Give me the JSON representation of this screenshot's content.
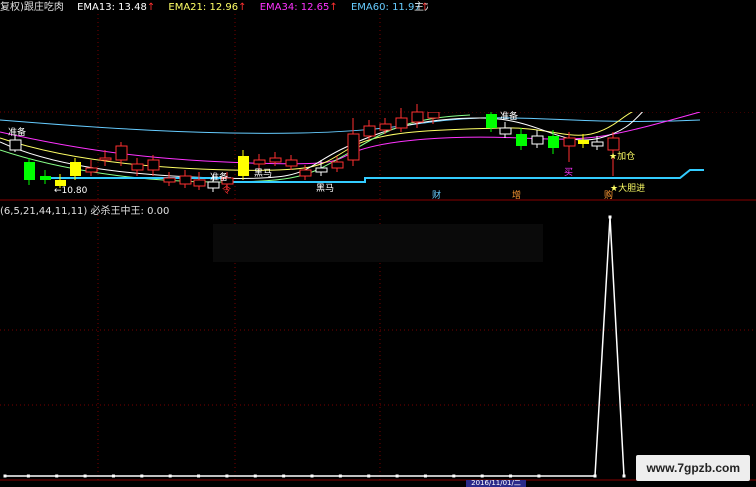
{
  "header": {
    "prefix": "复权)",
    "indicator_name": "跟庄吃肉",
    "ema13_label": "EMA13:",
    "ema13_value": "13.48",
    "ema21_label": "EMA21:",
    "ema21_value": "12.96",
    "ema34_label": "EMA34:",
    "ema34_value": "12.65",
    "ema60_label": "EMA60:",
    "ema60_value": "11.97",
    "arrow": "↑",
    "right_text": "主力"
  },
  "colors": {
    "ema13": "#ffffff",
    "ema21": "#ffff66",
    "ema34": "#ff33ff",
    "ema60": "#66ccff",
    "up_candle": "#ff3030",
    "down_candle": "#00ff00",
    "signal_candle": "#ffff00",
    "support_line": "#33ccff",
    "grid": "#880000"
  },
  "labels": {
    "zhunbei1": "准备",
    "zhunbei2": "准备",
    "zhunbei3": "准备",
    "low_price": "←10.80",
    "heima1": "黑马",
    "heima2": "黑马",
    "jiacang": "★加仓",
    "dadanjin": "★大胆进",
    "mai": "买",
    "cai": "财",
    "zeng": "增",
    "gou": "购",
    "ling": "令"
  },
  "indicator": {
    "params": "(6,5,21,44,11,11)",
    "name": "必杀王中王",
    "value": "0.00"
  },
  "axis": {
    "date_label": "2016/11/01/二"
  },
  "watermark": "www.7gpzb.com",
  "chart_data": {
    "type": "line",
    "title": "",
    "series": [
      {
        "name": "必杀王中王",
        "values": [
          0,
          0,
          0,
          0,
          0,
          0,
          0,
          0,
          0,
          0,
          0,
          0,
          0,
          0,
          0,
          0,
          0,
          0,
          0,
          0,
          0,
          1,
          0
        ]
      }
    ]
  }
}
